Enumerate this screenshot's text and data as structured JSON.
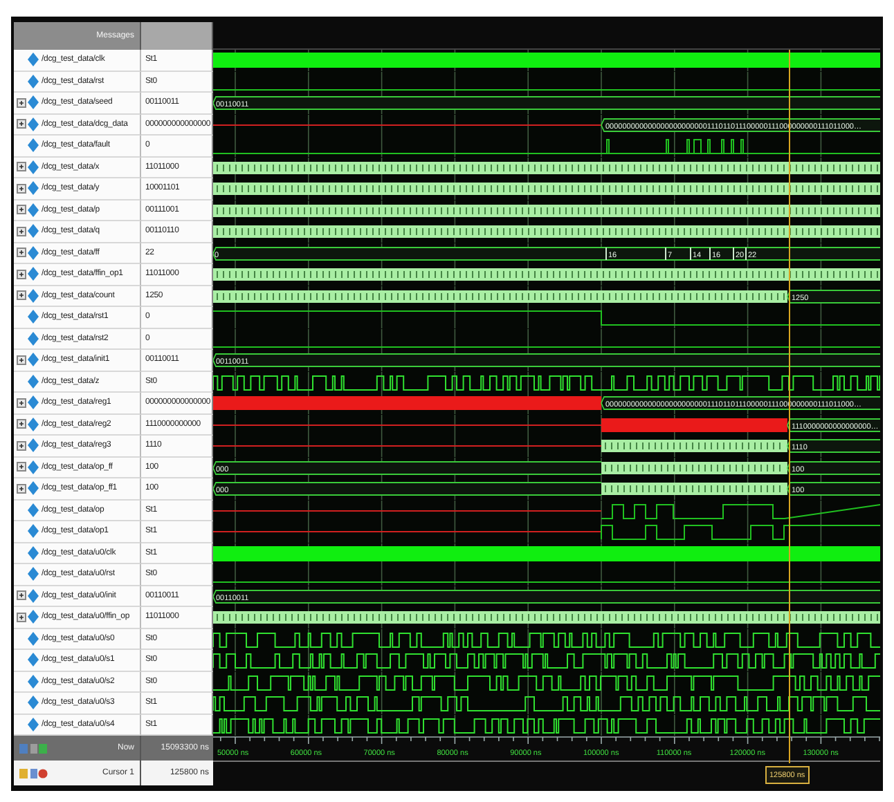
{
  "header": {
    "title": "Messages"
  },
  "signals": [
    {
      "name": "/dcg_test_data/clk",
      "value": "St1",
      "expandable": false,
      "wave": {
        "kind": "clock"
      }
    },
    {
      "name": "/dcg_test_data/rst",
      "value": "St0",
      "expandable": false,
      "wave": {
        "kind": "low"
      }
    },
    {
      "name": "/dcg_test_data/seed",
      "value": "00110011",
      "expandable": true,
      "wave": {
        "kind": "bus",
        "start_label": "00110011"
      }
    },
    {
      "name": "/dcg_test_data/dcg_data",
      "value": "000000000000000",
      "expandable": true,
      "wave": {
        "kind": "red_then_bus",
        "end_label": "000000000000000000000000111011011100000111000000000111011000…"
      }
    },
    {
      "name": "/dcg_test_data/fault",
      "value": "0",
      "expandable": false,
      "wave": {
        "kind": "pulses"
      }
    },
    {
      "name": "/dcg_test_data/x",
      "value": "11011000",
      "expandable": true,
      "wave": {
        "kind": "dense_bus"
      }
    },
    {
      "name": "/dcg_test_data/y",
      "value": "10001101",
      "expandable": true,
      "wave": {
        "kind": "dense_bus"
      }
    },
    {
      "name": "/dcg_test_data/p",
      "value": "00111001",
      "expandable": true,
      "wave": {
        "kind": "dense_bus"
      }
    },
    {
      "name": "/dcg_test_data/q",
      "value": "00110110",
      "expandable": true,
      "wave": {
        "kind": "dense_bus"
      }
    },
    {
      "name": "/dcg_test_data/ff",
      "value": "22",
      "expandable": true,
      "wave": {
        "kind": "stepped_bus",
        "labels": [
          "0",
          "16",
          "7",
          "14",
          "16",
          "20",
          "22"
        ]
      }
    },
    {
      "name": "/dcg_test_data/ffin_op1",
      "value": "11011000",
      "expandable": true,
      "wave": {
        "kind": "dense_bus"
      }
    },
    {
      "name": "/dcg_test_data/count",
      "value": "1250",
      "expandable": true,
      "wave": {
        "kind": "dense_until_cursor",
        "end_label": "1250"
      }
    },
    {
      "name": "/dcg_test_data/rst1",
      "value": "0",
      "expandable": false,
      "wave": {
        "kind": "high_then_low"
      }
    },
    {
      "name": "/dcg_test_data/rst2",
      "value": "0",
      "expandable": false,
      "wave": {
        "kind": "low"
      }
    },
    {
      "name": "/dcg_test_data/init1",
      "value": "00110011",
      "expandable": true,
      "wave": {
        "kind": "bus",
        "start_label": "00110011"
      }
    },
    {
      "name": "/dcg_test_data/z",
      "value": "St0",
      "expandable": false,
      "wave": {
        "kind": "digital"
      }
    },
    {
      "name": "/dcg_test_data/reg1",
      "value": "000000000000000",
      "expandable": true,
      "wave": {
        "kind": "red_band_then_bus",
        "end_label": "000000000000000000000000111011011100000111000000000111011000…"
      }
    },
    {
      "name": "/dcg_test_data/reg2",
      "value": "1110000000000",
      "expandable": true,
      "wave": {
        "kind": "red_line_band_bus",
        "end_label": "1110000000000000000…"
      }
    },
    {
      "name": "/dcg_test_data/reg3",
      "value": "1110",
      "expandable": true,
      "wave": {
        "kind": "dense_after_change",
        "end_label": "1110"
      }
    },
    {
      "name": "/dcg_test_data/op_ff",
      "value": "100",
      "expandable": true,
      "wave": {
        "kind": "dense_after_change",
        "start_label": "000",
        "end_label": "100"
      }
    },
    {
      "name": "/dcg_test_data/op_ff1",
      "value": "100",
      "expandable": true,
      "wave": {
        "kind": "dense_after_change",
        "start_label": "000",
        "end_label": "100"
      }
    },
    {
      "name": "/dcg_test_data/op",
      "value": "St1",
      "expandable": false,
      "wave": {
        "kind": "red_then_digital"
      }
    },
    {
      "name": "/dcg_test_data/op1",
      "value": "St1",
      "expandable": false,
      "wave": {
        "kind": "red_then_digital"
      }
    },
    {
      "name": "/dcg_test_data/u0/clk",
      "value": "St1",
      "expandable": false,
      "wave": {
        "kind": "clock"
      }
    },
    {
      "name": "/dcg_test_data/u0/rst",
      "value": "St0",
      "expandable": false,
      "wave": {
        "kind": "low"
      }
    },
    {
      "name": "/dcg_test_data/u0/init",
      "value": "00110011",
      "expandable": true,
      "wave": {
        "kind": "bus",
        "start_label": "00110011"
      }
    },
    {
      "name": "/dcg_test_data/u0/ffin_op",
      "value": "11011000",
      "expandable": true,
      "wave": {
        "kind": "dense_bus"
      }
    },
    {
      "name": "/dcg_test_data/u0/s0",
      "value": "St0",
      "expandable": false,
      "wave": {
        "kind": "digital"
      }
    },
    {
      "name": "/dcg_test_data/u0/s1",
      "value": "St0",
      "expandable": false,
      "wave": {
        "kind": "digital"
      }
    },
    {
      "name": "/dcg_test_data/u0/s2",
      "value": "St0",
      "expandable": false,
      "wave": {
        "kind": "digital"
      }
    },
    {
      "name": "/dcg_test_data/u0/s3",
      "value": "St1",
      "expandable": false,
      "wave": {
        "kind": "digital"
      }
    },
    {
      "name": "/dcg_test_data/u0/s4",
      "value": "St1",
      "expandable": false,
      "wave": {
        "kind": "digital"
      }
    }
  ],
  "now": {
    "label": "Now",
    "value": "15093300 ns"
  },
  "timeline": {
    "ticks": [
      "50000 ns",
      "60000 ns",
      "70000 ns",
      "80000 ns",
      "90000 ns",
      "100000 ns",
      "110000 ns",
      "120000 ns",
      "130000 ns"
    ]
  },
  "cursor": {
    "label": "Cursor 1",
    "value": "125800 ns",
    "marker_label": "125800 ns"
  }
}
